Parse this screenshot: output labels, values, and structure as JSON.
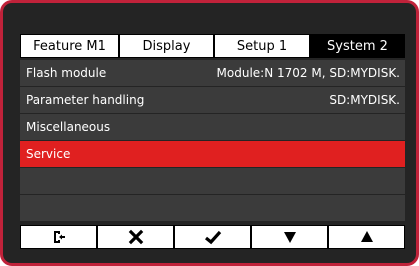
{
  "tabs": [
    {
      "label": "Feature  M1",
      "active": false
    },
    {
      "label": "Display",
      "active": false
    },
    {
      "label": "Setup 1",
      "active": false
    },
    {
      "label": "System 2",
      "active": true
    }
  ],
  "rows": [
    {
      "label": "Flash module",
      "value": "Module:N 1702 M, SD:MYDISK.",
      "selected": false
    },
    {
      "label": "Parameter handling",
      "value": "SD:MYDISK.",
      "selected": false
    },
    {
      "label": "Miscellaneous",
      "value": "",
      "selected": false
    },
    {
      "label": "Service",
      "value": "",
      "selected": true
    },
    {
      "label": "",
      "value": "",
      "selected": false
    },
    {
      "label": "",
      "value": "",
      "selected": false
    }
  ],
  "softkeys": [
    {
      "icon": "exit-icon"
    },
    {
      "icon": "cancel-x-icon"
    },
    {
      "icon": "confirm-check-icon"
    },
    {
      "icon": "arrow-down-icon"
    },
    {
      "icon": "arrow-up-icon"
    }
  ],
  "colors": {
    "frame": "#c0223a",
    "background": "#242424",
    "row": "#3b3b3b",
    "selected": "#e02020"
  }
}
